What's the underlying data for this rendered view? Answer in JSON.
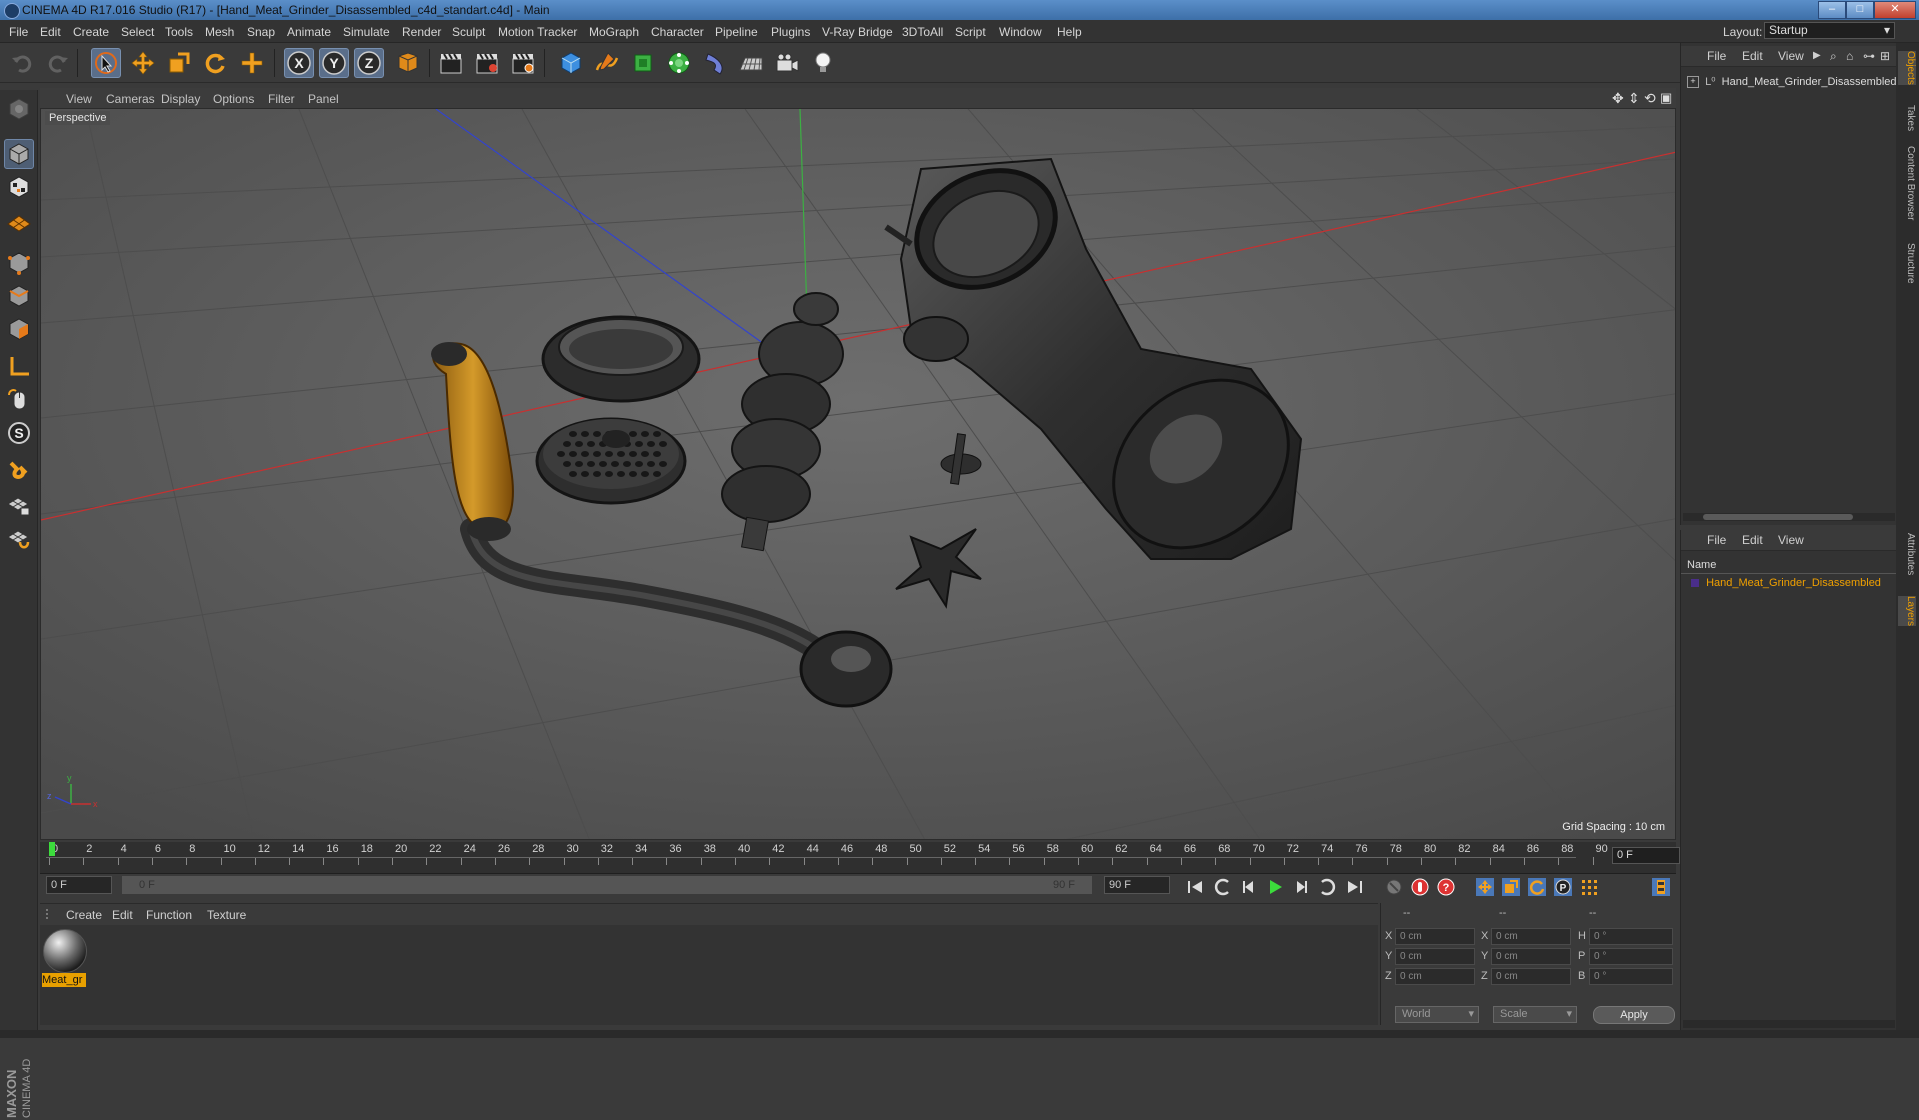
{
  "window": {
    "title": "CINEMA 4D R17.016 Studio (R17) - [Hand_Meat_Grinder_Disassembled_c4d_standart.c4d] - Main"
  },
  "menubar": {
    "items": [
      "File",
      "Edit",
      "Create",
      "Select",
      "Tools",
      "Mesh",
      "Snap",
      "Animate",
      "Simulate",
      "Render",
      "Sculpt",
      "Motion Tracker",
      "MoGraph",
      "Character",
      "Pipeline",
      "Plugins",
      "V-Ray Bridge",
      "3DToAll",
      "Script",
      "Window",
      "Help"
    ],
    "layout_label": "Layout:",
    "layout_value": "Startup"
  },
  "toolbar": {
    "axis_x": "X",
    "axis_y": "Y",
    "axis_z": "Z"
  },
  "viewport": {
    "menu": [
      "View",
      "Cameras",
      "Display",
      "Options",
      "Filter",
      "Panel"
    ],
    "camera_label": "Perspective",
    "grid_spacing": "Grid Spacing : 10 cm"
  },
  "timeline": {
    "ticks": [
      "0",
      "2",
      "4",
      "6",
      "8",
      "10",
      "12",
      "14",
      "16",
      "18",
      "20",
      "22",
      "24",
      "26",
      "28",
      "30",
      "32",
      "34",
      "36",
      "38",
      "40",
      "42",
      "44",
      "46",
      "48",
      "50",
      "52",
      "54",
      "56",
      "58",
      "60",
      "62",
      "64",
      "66",
      "68",
      "70",
      "72",
      "74",
      "76",
      "78",
      "80",
      "82",
      "84",
      "86",
      "88",
      "90"
    ],
    "current_frame": "0 F"
  },
  "transport": {
    "start_frame": "0 F",
    "range_start": "0 F",
    "range_end": "90 F",
    "end_frame": "90 F"
  },
  "material_manager": {
    "menu": [
      "Create",
      "Edit",
      "Function",
      "Texture"
    ],
    "material_name": "Meat_gr"
  },
  "coordinates": {
    "header": [
      "--",
      "--",
      "--"
    ],
    "pos_labels": [
      "X",
      "Y",
      "Z"
    ],
    "pos_values": [
      "0 cm",
      "0 cm",
      "0 cm"
    ],
    "size_labels": [
      "X",
      "Y",
      "Z"
    ],
    "size_values": [
      "0 cm",
      "0 cm",
      "0 cm"
    ],
    "rot_labels": [
      "H",
      "P",
      "B"
    ],
    "rot_values": [
      "0 °",
      "0 °",
      "0 °"
    ],
    "world_select": "World",
    "scale_select": "Scale",
    "apply_label": "Apply"
  },
  "object_manager": {
    "menu": [
      "File",
      "Edit",
      "View"
    ],
    "object_name": "Hand_Meat_Grinder_Disassembled"
  },
  "layer_manager": {
    "menu": [
      "File",
      "Edit",
      "View"
    ],
    "column_name": "Name",
    "layer_name": "Hand_Meat_Grinder_Disassembled"
  },
  "side_tabs": [
    "Objects",
    "Takes",
    "Content Browser",
    "Structure",
    "Attributes",
    "Layers"
  ],
  "branding": "MAXON CINEMA 4D",
  "colors": {
    "accent_orange": "#e8a000",
    "x_axis": "#cc3333",
    "y_axis": "#33aa33",
    "z_axis": "#3344cc"
  }
}
